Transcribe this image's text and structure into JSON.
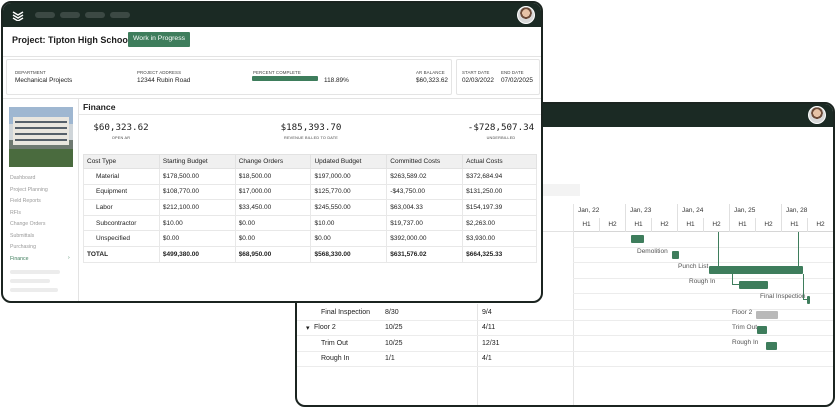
{
  "back_window": {
    "gantt": {
      "days": [
        "Jan, 22",
        "Jan, 23",
        "Jan, 24",
        "Jan, 25",
        "Jan, 28"
      ],
      "halves": [
        "H1",
        "H2",
        "H1",
        "H2",
        "H1",
        "H2",
        "H1",
        "H2",
        "H1",
        "H2"
      ],
      "task_labels": [
        "Demolition",
        "Punch List",
        "Rough In",
        "Final Inspection",
        "Floor 2",
        "Trim Out",
        "Rough In"
      ]
    },
    "rows": [
      {
        "name": "Final Inspection",
        "start": "8/30",
        "end": "9/4",
        "expander": ""
      },
      {
        "name": "Floor 2",
        "start": "10/25",
        "end": "4/11",
        "expander": "▾"
      },
      {
        "name": "Trim Out",
        "start": "10/25",
        "end": "12/31",
        "expander": ""
      },
      {
        "name": "Rough In",
        "start": "1/1",
        "end": "4/1",
        "expander": ""
      }
    ]
  },
  "front_window": {
    "project_title": "Project: Tipton High School",
    "status_badge": "Work in Progress",
    "meta": {
      "department_label": "DEPARTMENT",
      "department": "Mechanical Projects",
      "address_label": "PROJECT ADDRESS",
      "address": "12344 Rubin Road",
      "percent_label": "PERCENT COMPLETE",
      "percent": "118.89%",
      "percent_fill": 1.0,
      "ar_label": "AR BALANCE",
      "ar": "$60,323.62",
      "start_label": "START DATE",
      "start": "02/03/2022",
      "end_label": "END DATE",
      "end": "07/02/2025"
    },
    "nav": {
      "items": [
        "Dashboard",
        "Project Planning",
        "Field Reports",
        "RFIs",
        "Change Orders",
        "Submittals",
        "Purchasing",
        "Finance"
      ],
      "active": "Finance",
      "caret": "›"
    },
    "finance": {
      "title": "Finance",
      "kpis": [
        {
          "value": "$60,323.62",
          "label": "OPEN AR"
        },
        {
          "value": "$185,393.70",
          "label": "REVENUE BILLED TO DATE"
        },
        {
          "value": "-$728,507.34",
          "label": "UNDERBILLED"
        }
      ],
      "table": {
        "headers": [
          "Cost Type",
          "Starting Budget",
          "Change Orders",
          "Updated Budget",
          "Committed Costs",
          "Actual Costs"
        ],
        "rows": [
          [
            "Material",
            "$178,500.00",
            "$18,500.00",
            "$197,000.00",
            "$263,589.02",
            "$372,684.94"
          ],
          [
            "Equipment",
            "$108,770.00",
            "$17,000.00",
            "$125,770.00",
            "-$43,750.00",
            "$131,250.00"
          ],
          [
            "Labor",
            "$212,100.00",
            "$33,450.00",
            "$245,550.00",
            "$63,004.33",
            "$154,197.39"
          ],
          [
            "Subcontractor",
            "$10.00",
            "$0.00",
            "$10.00",
            "$19,737.00",
            "$2,263.00"
          ],
          [
            "Unspecified",
            "$0.00",
            "$0.00",
            "$0.00",
            "$392,000.00",
            "$3,930.00"
          ]
        ],
        "total": [
          "TOTAL",
          "$499,380.00",
          "$68,950.00",
          "$568,330.00",
          "$631,576.02",
          "$664,325.33"
        ]
      }
    }
  }
}
